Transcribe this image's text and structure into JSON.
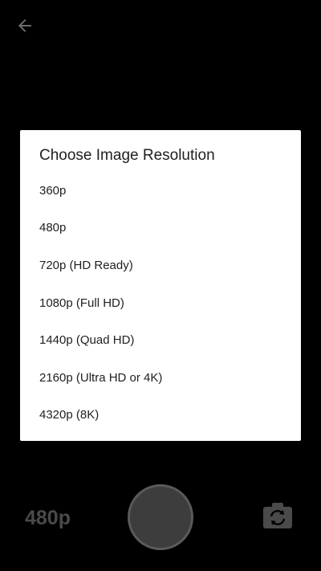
{
  "dialog": {
    "title": "Choose Image Resolution",
    "options": [
      "360p",
      "480p",
      "720p (HD Ready)",
      "1080p (Full HD)",
      "1440p (Quad HD)",
      "2160p (Ultra HD or 4K)",
      "4320p (8K)"
    ]
  },
  "camera": {
    "current_resolution": "480p"
  },
  "icons": {
    "back": "arrow-left-icon",
    "switch_camera": "camera-switch-icon"
  },
  "colors": {
    "background": "#000000",
    "dialog_background": "#ffffff",
    "dialog_text": "#212121",
    "controls_gray": "#4a4a4a"
  }
}
